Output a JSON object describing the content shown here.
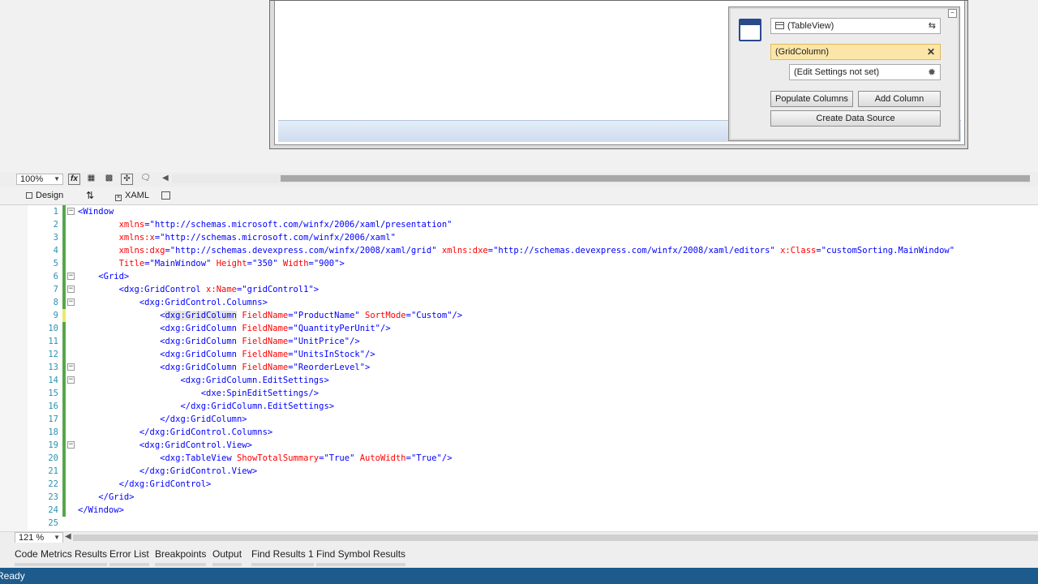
{
  "smart_tag": {
    "view": "(TableView)",
    "column": "(GridColumn)",
    "edit_settings": "(Edit Settings not set)",
    "populate_columns": "Populate Columns",
    "add_column": "Add Column",
    "create_data_source": "Create Data Source",
    "close_glyph": "✕"
  },
  "design_toolbar": {
    "zoom": "100%"
  },
  "tabs": {
    "design": "Design",
    "xaml": "XAML"
  },
  "editor_zoom": "121 %",
  "code_lines": [
    {
      "n": "1",
      "segs": [
        [
          "<Window",
          "blue"
        ]
      ]
    },
    {
      "n": "2",
      "segs": [
        [
          "        ",
          ""
        ],
        [
          "xmlns",
          "red"
        ],
        [
          "=\"http://schemas.microsoft.com/winfx/2006/xaml/presentation\"",
          "blue"
        ]
      ]
    },
    {
      "n": "3",
      "segs": [
        [
          "        ",
          ""
        ],
        [
          "xmlns:x",
          "red"
        ],
        [
          "=\"http://schemas.microsoft.com/winfx/2006/xaml\"",
          "blue"
        ]
      ]
    },
    {
      "n": "4",
      "segs": [
        [
          "        ",
          ""
        ],
        [
          "xmlns:dxg",
          "red"
        ],
        [
          "=\"http://schemas.devexpress.com/winfx/2008/xaml/grid\" ",
          "blue"
        ],
        [
          "xmlns:dxe",
          "red"
        ],
        [
          "=\"http://schemas.devexpress.com/winfx/2008/xaml/editors\" ",
          "blue"
        ],
        [
          "x:Class",
          "red"
        ],
        [
          "=\"customSorting.MainWindow\"",
          "blue"
        ]
      ]
    },
    {
      "n": "5",
      "segs": [
        [
          "        ",
          ""
        ],
        [
          "Title",
          "red"
        ],
        [
          "=\"MainWindow\" ",
          "blue"
        ],
        [
          "Height",
          "red"
        ],
        [
          "=\"350\" ",
          "blue"
        ],
        [
          "Width",
          "red"
        ],
        [
          "=\"900\"",
          "blue"
        ],
        [
          ">",
          "blue"
        ]
      ]
    },
    {
      "n": "6",
      "segs": [
        [
          "    ",
          ""
        ],
        [
          "<Grid>",
          "blue"
        ]
      ]
    },
    {
      "n": "7",
      "segs": [
        [
          "        ",
          ""
        ],
        [
          "<dxg:GridControl ",
          "blue"
        ],
        [
          "x:Name",
          "red"
        ],
        [
          "=\"gridControl1\">",
          "blue"
        ]
      ]
    },
    {
      "n": "8",
      "segs": [
        [
          "            ",
          ""
        ],
        [
          "<dxg:GridControl.Columns>",
          "blue"
        ]
      ]
    },
    {
      "n": "9",
      "segs": [
        [
          "                ",
          ""
        ],
        [
          "<",
          "blue"
        ],
        [
          "dxg:GridColumn",
          "hl"
        ],
        [
          " FieldName",
          "red"
        ],
        [
          "=\"ProductName\" ",
          "blue"
        ],
        [
          "SortMode",
          "red"
        ],
        [
          "=\"Custom\"/>",
          "blue"
        ]
      ]
    },
    {
      "n": "10",
      "segs": [
        [
          "                ",
          ""
        ],
        [
          "<dxg:GridColumn ",
          "blue"
        ],
        [
          "FieldName",
          "red"
        ],
        [
          "=\"QuantityPerUnit\"/>",
          "blue"
        ]
      ]
    },
    {
      "n": "11",
      "segs": [
        [
          "                ",
          ""
        ],
        [
          "<dxg:GridColumn ",
          "blue"
        ],
        [
          "FieldName",
          "red"
        ],
        [
          "=\"UnitPrice\"/>",
          "blue"
        ]
      ]
    },
    {
      "n": "12",
      "segs": [
        [
          "                ",
          ""
        ],
        [
          "<dxg:GridColumn ",
          "blue"
        ],
        [
          "FieldName",
          "red"
        ],
        [
          "=\"UnitsInStock\"/>",
          "blue"
        ]
      ]
    },
    {
      "n": "13",
      "segs": [
        [
          "                ",
          ""
        ],
        [
          "<dxg:GridColumn ",
          "blue"
        ],
        [
          "FieldName",
          "red"
        ],
        [
          "=\"ReorderLevel\">",
          "blue"
        ]
      ]
    },
    {
      "n": "14",
      "segs": [
        [
          "                    ",
          ""
        ],
        [
          "<dxg:GridColumn.EditSettings>",
          "blue"
        ]
      ]
    },
    {
      "n": "15",
      "segs": [
        [
          "                        ",
          ""
        ],
        [
          "<dxe:SpinEditSettings/>",
          "blue"
        ]
      ]
    },
    {
      "n": "16",
      "segs": [
        [
          "                    ",
          ""
        ],
        [
          "</dxg:GridColumn.EditSettings>",
          "blue"
        ]
      ]
    },
    {
      "n": "17",
      "segs": [
        [
          "                ",
          ""
        ],
        [
          "</dxg:GridColumn>",
          "blue"
        ]
      ]
    },
    {
      "n": "18",
      "segs": [
        [
          "            ",
          ""
        ],
        [
          "</dxg:GridControl.Columns>",
          "blue"
        ]
      ]
    },
    {
      "n": "19",
      "segs": [
        [
          "            ",
          ""
        ],
        [
          "<dxg:GridControl.View>",
          "blue"
        ]
      ]
    },
    {
      "n": "20",
      "segs": [
        [
          "                ",
          ""
        ],
        [
          "<dxg:TableView ",
          "blue"
        ],
        [
          "ShowTotalSummary",
          "red"
        ],
        [
          "=\"True\" ",
          "blue"
        ],
        [
          "AutoWidth",
          "red"
        ],
        [
          "=\"True\"/>",
          "blue"
        ]
      ]
    },
    {
      "n": "21",
      "segs": [
        [
          "            ",
          ""
        ],
        [
          "</dxg:GridControl.View>",
          "blue"
        ]
      ]
    },
    {
      "n": "22",
      "segs": [
        [
          "        ",
          ""
        ],
        [
          "</dxg:GridControl>",
          "blue"
        ]
      ]
    },
    {
      "n": "23",
      "segs": [
        [
          "    ",
          ""
        ],
        [
          "</Grid>",
          "blue"
        ]
      ]
    },
    {
      "n": "24",
      "segs": [
        [
          "</Window>",
          "blue"
        ]
      ]
    },
    {
      "n": "25",
      "segs": []
    }
  ],
  "tool_tabs": [
    "Code Metrics Results",
    "Error List",
    "Breakpoints",
    "Output",
    "Find Results 1",
    "Find Symbol Results"
  ],
  "status": "Ready",
  "colors": {
    "status_bar": "#1c5b8c",
    "change_green": "#57a64a",
    "change_yellow": "#eee86b",
    "tag_blue": "#0000ff",
    "attr_red": "#ff0000",
    "line_number": "#2b91af"
  }
}
